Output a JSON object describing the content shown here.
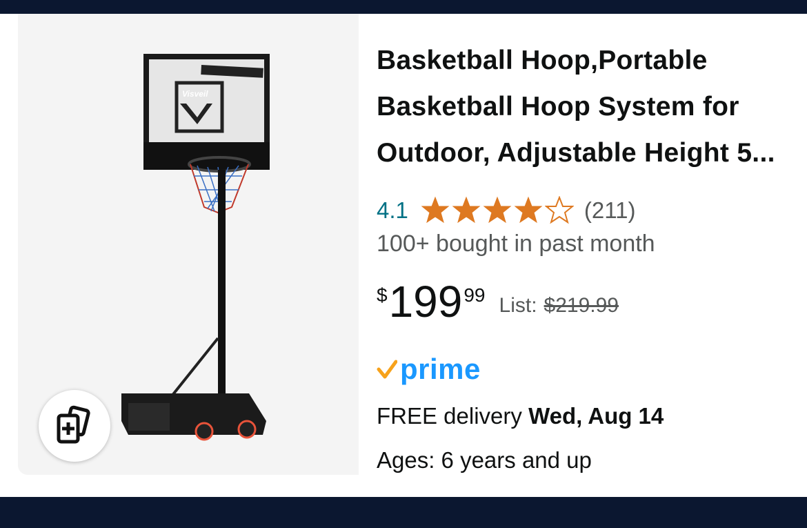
{
  "product": {
    "title_lines": [
      "Basketball Hoop,Portable",
      "Basketball Hoop System for",
      "Outdoor, Adjustable Height 5..."
    ],
    "image_icon": "basketball-hoop-product-image",
    "image_brand_text": "Visveil",
    "rating_value": "4.1",
    "rating": 4.1,
    "star_color": "#de7921",
    "review_count": "(211)",
    "bought_text": "100+ bought in past month",
    "price_symbol": "$",
    "price_whole": "199",
    "price_fraction": "99",
    "list_label": "List:",
    "list_price": "$219.99",
    "prime_label": "prime",
    "prime_color": "#1a98ff",
    "delivery_prefix": "FREE delivery ",
    "delivery_date": "Wed, Aug 14",
    "ages": "Ages: 6 years and up"
  },
  "compare_button_icon": "add-to-compare-cards-icon",
  "colors": {
    "background_bar": "#0b1730",
    "link_teal": "#007185",
    "text_gray": "#565959"
  }
}
